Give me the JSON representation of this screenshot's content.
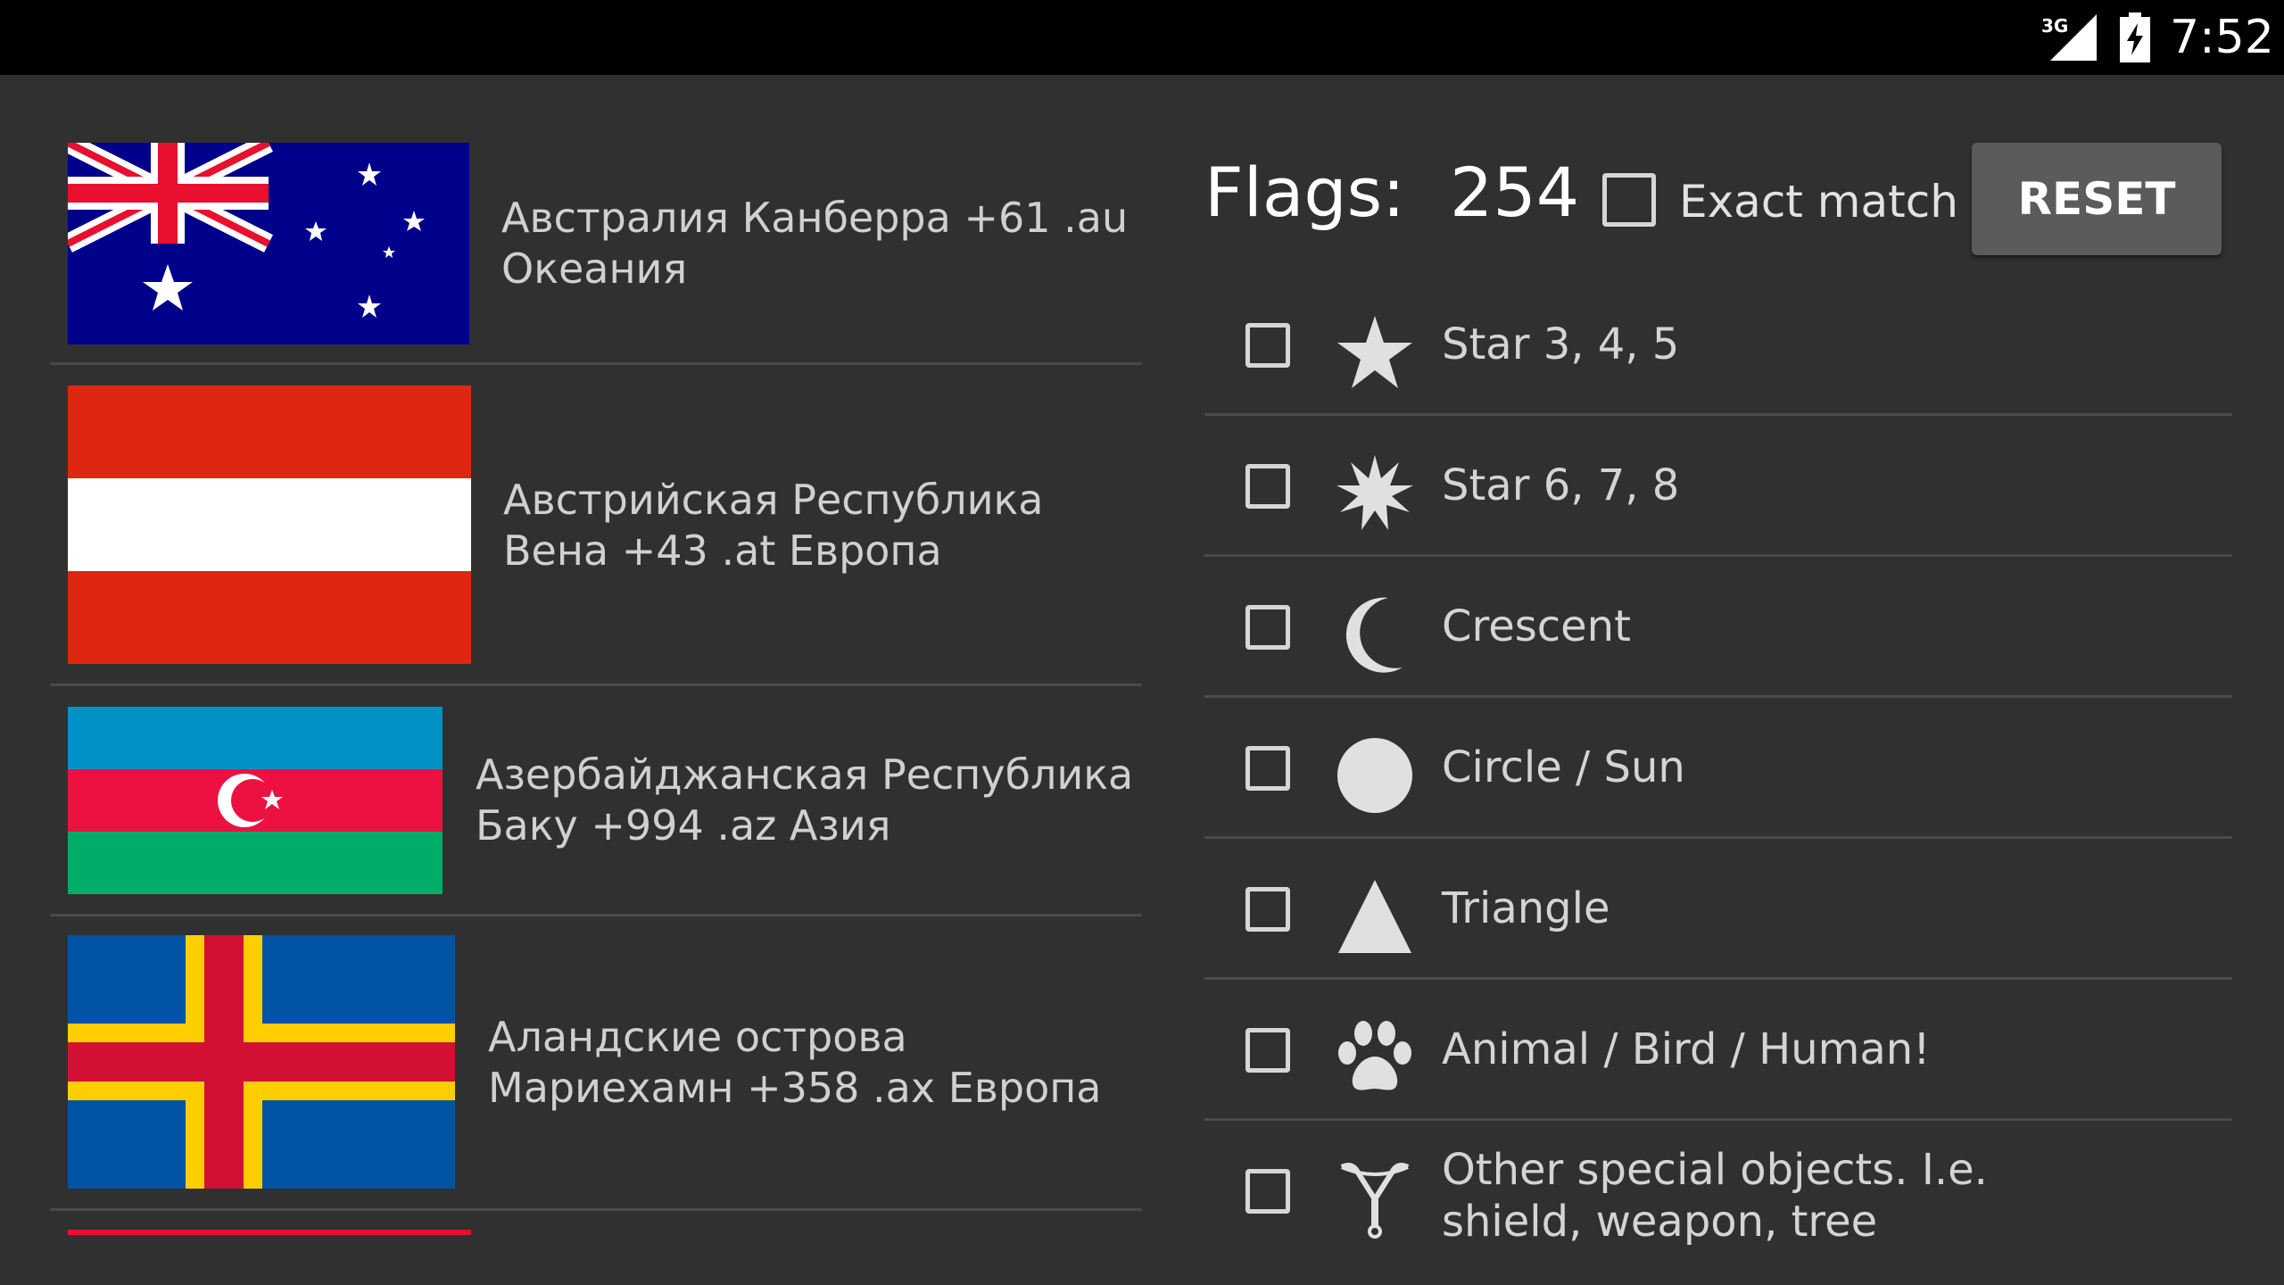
{
  "status_bar": {
    "network": "3G",
    "time": "7:52"
  },
  "countries": [
    {
      "line1": "Австралия Канберра +61 .au",
      "line2": "Океания",
      "flag": "australia-flag"
    },
    {
      "line1": "Австрийская Республика",
      "line2": "Вена +43 .at Европа",
      "flag": "austria-flag"
    },
    {
      "line1": "Азербайджанская Республика",
      "line2": "Баку +994 .az Азия",
      "flag": "azerbaijan-flag"
    },
    {
      "line1": "Аландские острова",
      "line2": "Мариехамн +358 .ax Европа",
      "flag": "aland-flag"
    }
  ],
  "header": {
    "flags_label": "Flags:",
    "flags_count": "254",
    "exact_match_label": "Exact match",
    "reset_label": "RESET"
  },
  "filters": [
    {
      "label": "Star 3, 4, 5",
      "icon": "star-5-icon"
    },
    {
      "label": "Star 6, 7, 8",
      "icon": "star-8-icon"
    },
    {
      "label": "Crescent",
      "icon": "crescent-icon"
    },
    {
      "label": "Circle / Sun",
      "icon": "circle-icon"
    },
    {
      "label": "Triangle",
      "icon": "triangle-icon"
    },
    {
      "label": "Animal / Bird / Human!",
      "icon": "paw-icon"
    },
    {
      "label": "Other special objects. I.e. shield, weapon, tree",
      "icon": "slingshot-icon"
    }
  ],
  "colors": {
    "background": "#303030",
    "status_bar": "#000000",
    "reset_button": "#5b5b5b"
  }
}
